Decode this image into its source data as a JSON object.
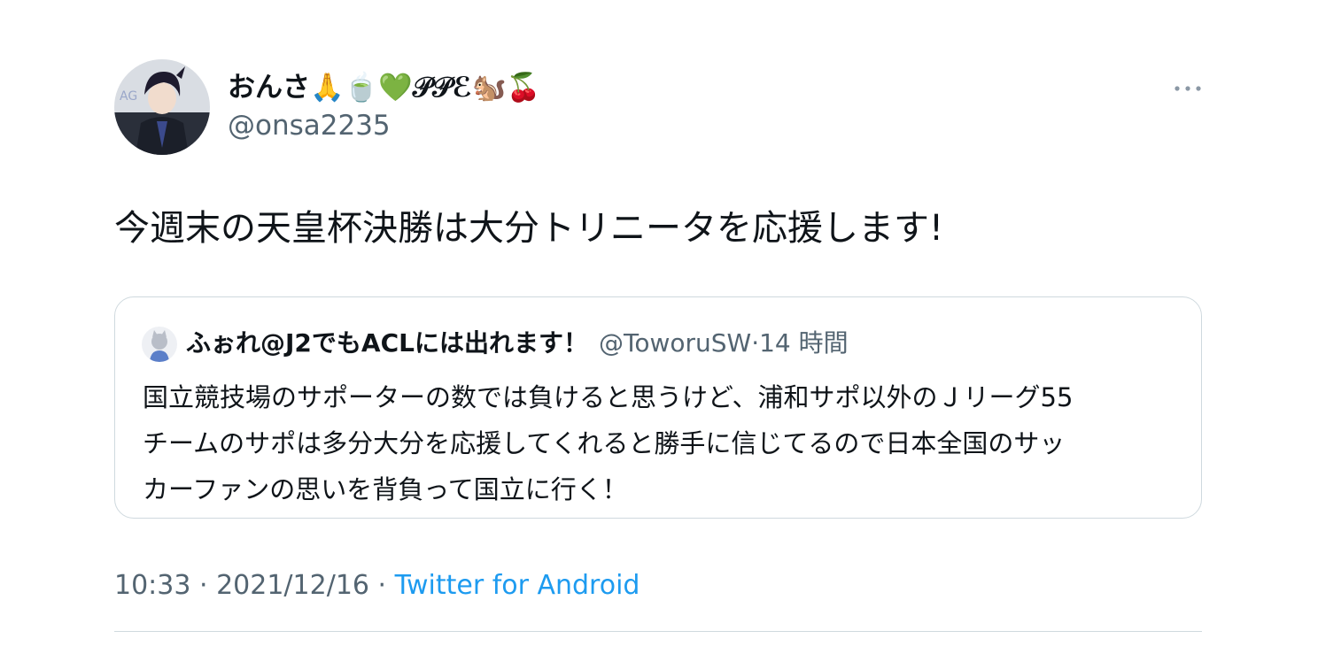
{
  "tweet": {
    "author": {
      "display_name": "おんさ🙏🍵💚𝒫𝒫ℰ🐿️🍒",
      "handle": "@onsa2235",
      "avatar_icon": "user-avatar"
    },
    "text": "今週末の天皇杯決勝は大分トリニータを応援します!",
    "more_icon": "more-horizontal-icon",
    "quoted": {
      "author": {
        "display_name": "ふぉれ@J2でもACLには出れます！",
        "handle": "@ToworuSW",
        "separator": "·",
        "time": "14 時間",
        "avatar_icon": "quoted-user-avatar"
      },
      "text_lines": [
        "国立競技場のサポーターの数では負けると思うけど、浦和サポ以外のＪリーグ55",
        "チームのサポは多分大分を応援してくれると勝手に信じてるので日本全国のサッ",
        "カーファンの思いを背負って国立に行く！"
      ]
    },
    "meta": {
      "time": "10:33",
      "separator1": " · ",
      "date": "2021/12/16",
      "separator2": " · ",
      "source": "Twitter for Android"
    }
  },
  "colors": {
    "text_primary": "#0f1419",
    "text_secondary": "#536471",
    "link": "#1d9bf0",
    "border": "#cfd9de"
  }
}
